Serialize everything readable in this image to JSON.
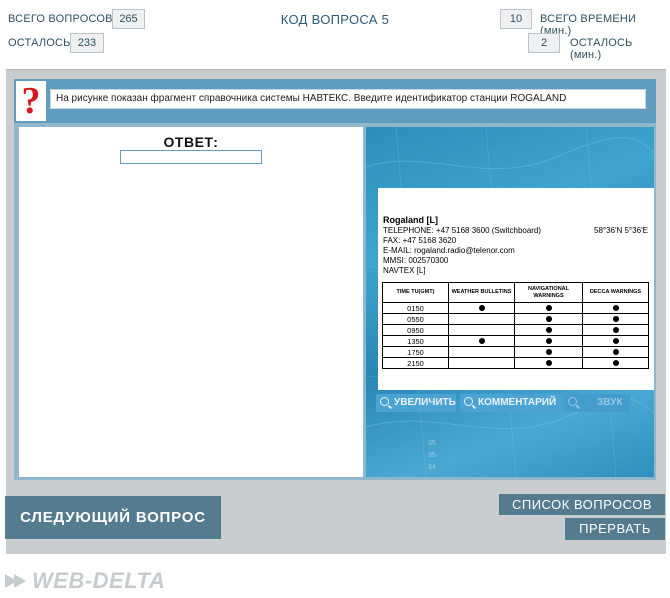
{
  "header": {
    "total_questions_label": "ВСЕГО ВОПРОСОВ",
    "total_questions_value": "265",
    "remaining_label": "ОСТАЛОСЬ",
    "remaining_value": "233",
    "question_code": "КОД ВОПРОСА 5",
    "total_time_value": "10",
    "total_time_label": "ВСЕГО ВРЕМЕНИ (мин.)",
    "time_left_value": "2",
    "time_left_label": "ОСТАЛОСЬ (мин.)"
  },
  "question": {
    "icon": "question-mark-icon",
    "text": "На рисунке показан фрагмент справочника системы НАВТЕКС. Введите идентификатор станции ROGALAND"
  },
  "answer": {
    "label": "ОТВЕТ:",
    "value": ""
  },
  "station": {
    "name": "Rogaland [L]",
    "telephone": "TELEPHONE: +47 5168 3600 (Switchboard)",
    "coords": "58°36'N 5°36'E",
    "fax": "FAX: +47 5168 3620",
    "email": "E-MAIL: rogaland.radio@telenor.com",
    "mmsi": "MMSI: 002570300",
    "navtex": "NAVTEX [L]"
  },
  "schedule": {
    "headers": [
      "TIME TU(GMT)",
      "WEATHER BULLETINS",
      "NAVIGATIONAL WARNINGS",
      "DECCA WARNINGS"
    ],
    "rows": [
      {
        "time": "0150",
        "weather": true,
        "nav": true,
        "decca": true
      },
      {
        "time": "0550",
        "weather": false,
        "nav": true,
        "decca": true
      },
      {
        "time": "0950",
        "weather": false,
        "nav": true,
        "decca": true
      },
      {
        "time": "1350",
        "weather": true,
        "nav": true,
        "decca": true
      },
      {
        "time": "1750",
        "weather": false,
        "nav": true,
        "decca": true
      },
      {
        "time": "2150",
        "weather": false,
        "nav": true,
        "decca": true
      }
    ]
  },
  "image_tools": {
    "zoom_label": "УВЕЛИЧИТЬ",
    "comment_label": "КОММЕНТАРИЙ",
    "sound_label": "ЗВУК"
  },
  "chart_digits": [
    "35",
    "35",
    "34"
  ],
  "footer": {
    "next_label": "СЛЕДУЮЩИЙ ВОПРОС",
    "list_label": "СПИСОК ВОПРОСОВ",
    "abort_label": "ПРЕРВАТЬ",
    "logo_text": "WEB-DELTA"
  },
  "colors": {
    "accent": "#5f9cc0",
    "button": "#557b8f",
    "question_mark": "#d6171e",
    "tool_button": "#4aa3d3"
  }
}
